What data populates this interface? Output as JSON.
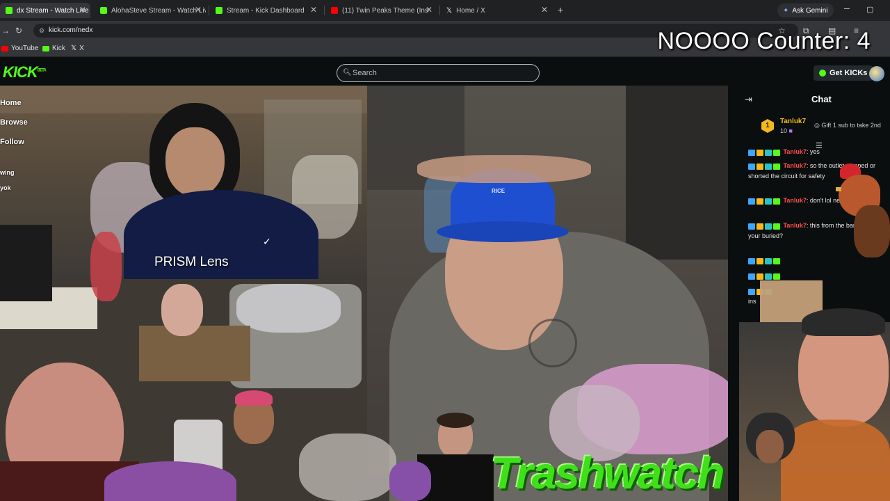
{
  "browser": {
    "tabs": [
      {
        "label": "dx Stream - Watch Live o",
        "active": true,
        "favicon_color": "#53fc18"
      },
      {
        "label": "AlohaSteve Stream - Watch Live",
        "active": false,
        "favicon_color": "#53fc18"
      },
      {
        "label": "Stream - Kick Dashboard",
        "active": false,
        "favicon_color": "#53fc18"
      },
      {
        "label": "(11) Twin Peaks Theme (Instrum",
        "active": false,
        "favicon_color": "#ff0000"
      },
      {
        "label": "Home / X",
        "active": false,
        "favicon_color": "#ffffff"
      }
    ],
    "new_tab": "+",
    "gemini_label": "Ask Gemini",
    "url": "kick.com/nedx",
    "bookmarks": [
      {
        "label": "YouTube",
        "color": "#ff0000"
      },
      {
        "label": "Kick",
        "color": "#53fc18"
      },
      {
        "label": "X",
        "color": "#ffffff"
      }
    ]
  },
  "overlay": {
    "counter_text": "NOOOO Counter: 4",
    "prism_label": "PRISM Lens",
    "hat_text": "RICE",
    "banner_text": "Trashwatch"
  },
  "kick": {
    "logo": "KICK",
    "logo_sup": "BETA",
    "search_placeholder": "Search",
    "get_kicks_label": "Get KICKs"
  },
  "sidebar": {
    "items": [
      "Home",
      "Browse",
      "Following",
      "wing",
      "yok"
    ]
  },
  "chat": {
    "title": "Chat",
    "pinned": {
      "rank": "1",
      "user": "Tanluk7",
      "count": "10",
      "gift_text": "Gift 1 sub to take 2nd"
    },
    "messages": [
      {
        "user": "Tanluk7",
        "text": "yes"
      },
      {
        "user": "Tanluk7",
        "text": "so the outlet stopped or shorted the circuit for safety"
      },
      {
        "user": "Tanluk7",
        "text": "don't lol never Ned"
      },
      {
        "user": "Tanluk7",
        "text": "this from the barn or ever your buried?"
      },
      {
        "user": "",
        "text": ""
      },
      {
        "user": "",
        "text": ""
      },
      {
        "user": "",
        "text": "ins"
      }
    ]
  },
  "colors": {
    "kick_green": "#53fc18",
    "username_red": "#ff4d4d",
    "badge_blue": "#3ba7ff",
    "badge_orange": "#f4b91d",
    "badge_green": "#53fc18"
  }
}
